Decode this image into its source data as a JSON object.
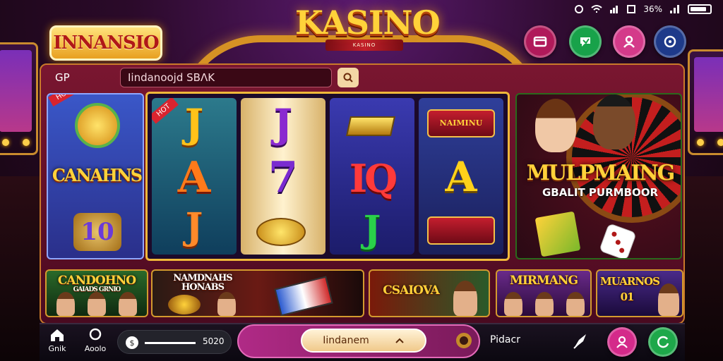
{
  "status_bar": {
    "battery_text": "36%"
  },
  "brand": {
    "label": "INNANSIO"
  },
  "logo": {
    "title": "KASINO",
    "ribbon": "KASINO"
  },
  "topbar": {
    "label": "GP",
    "search_value": "Iindanoojd SBɅK"
  },
  "left_promo": {
    "tag": "HOT",
    "title": "CANAHNS",
    "number": "10"
  },
  "reels": {
    "col1": [
      "J",
      "A",
      "J"
    ],
    "col2": [
      "J",
      "7",
      ""
    ],
    "col3": [
      "",
      "IQ",
      "J"
    ],
    "col4": [
      "NAIMINU",
      "A",
      ""
    ],
    "hot_tag": "HOT"
  },
  "right_promo": {
    "title": "MULPMAING",
    "subtitle": "GBALIT PURMBOOR"
  },
  "cards": [
    {
      "title": "CANDOHNO",
      "sub": "GAIADS GRNIO"
    },
    {
      "title": "NAMDNAHS HONABS",
      "sub": ""
    },
    {
      "title": "CSAIOVA",
      "sub": ""
    },
    {
      "title": "MIRMANG",
      "sub": ""
    },
    {
      "title": "MUARNOS 01",
      "sub": ""
    }
  ],
  "bottom_nav": {
    "home_label": "Gnik",
    "search_label": "Aoolo",
    "slider_value": "5020",
    "spin_label": "Iindanem",
    "right_label": "Pidacr"
  },
  "colors": {
    "accent_gold": "#ffd23a",
    "panel": "#7a1630",
    "spin": "#b02a86"
  }
}
